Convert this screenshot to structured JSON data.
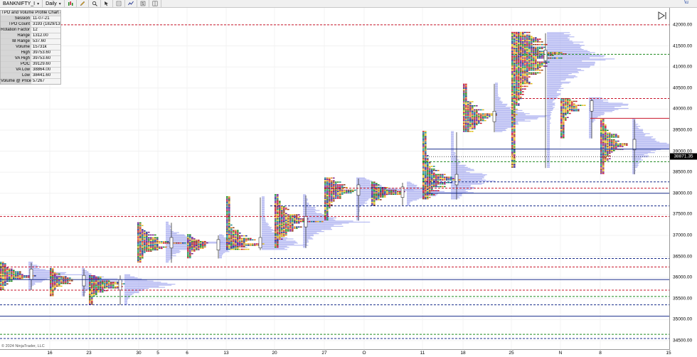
{
  "toolbar": {
    "instrument": "BANKNIFTY_I",
    "interval": "Daily",
    "chevron": "▾",
    "icons": [
      "bars-style-icon",
      "pencil-icon",
      "zoom-icon",
      "crosshair-icon",
      "cursor-icon",
      "properties-icon",
      "indicator-icon",
      "strategy-icon",
      "layout-icon"
    ]
  },
  "stats_panel": {
    "title": "TPO and Volume Profile Chart (v4)",
    "rows": [
      {
        "k": "Session",
        "v": "11-07-21"
      },
      {
        "k": "TPO Count",
        "v": "3193 (1829/135"
      },
      {
        "k": "Rotation Factor",
        "v": "12"
      },
      {
        "k": "Range",
        "v": "1312.00"
      },
      {
        "k": "IB Range",
        "v": "537.60"
      },
      {
        "k": "Volume",
        "v": "15731k"
      },
      {
        "k": "High",
        "v": "39753.60"
      },
      {
        "k": "VA High",
        "v": "39753.60"
      },
      {
        "k": "POC",
        "v": "39129.60"
      },
      {
        "k": "VA Low",
        "v": "38864.00"
      },
      {
        "k": "Low",
        "v": "38441.60"
      },
      {
        "k": "Volume @ Price",
        "v": "57267"
      }
    ]
  },
  "y_axis": {
    "min": 34500,
    "max": 42100,
    "ticks": [
      "42000.00",
      "41500.00",
      "41000.00",
      "40500.00",
      "40000.00",
      "39500.00",
      "39000.00",
      "38500.00",
      "38000.00",
      "37500.00",
      "37000.00",
      "36500.00",
      "36000.00",
      "35500.00",
      "35000.00",
      "34500.00"
    ],
    "current_price": "38871.35"
  },
  "x_axis": {
    "labels": [
      "16",
      "23",
      "30",
      "5",
      "6",
      "13",
      "20",
      "27",
      "O",
      "11",
      "18",
      "25",
      "N",
      "8",
      "15"
    ]
  },
  "copyright": "© 2024 NinjaTrader, LLC",
  "corner_text": "\\u",
  "colors": {
    "value_area_line": "#1a2e8c",
    "range_line": "#c8142a",
    "poc_line": "#1e8a1e",
    "volume_profile": "#9ea3ee",
    "tpo_palette": [
      "#c8142a",
      "#1e8a1e",
      "#1a2e8c",
      "#e07b1a",
      "#7a1a8a",
      "#1a8a8a",
      "#e0c01a",
      "#8a3a1a"
    ]
  }
}
